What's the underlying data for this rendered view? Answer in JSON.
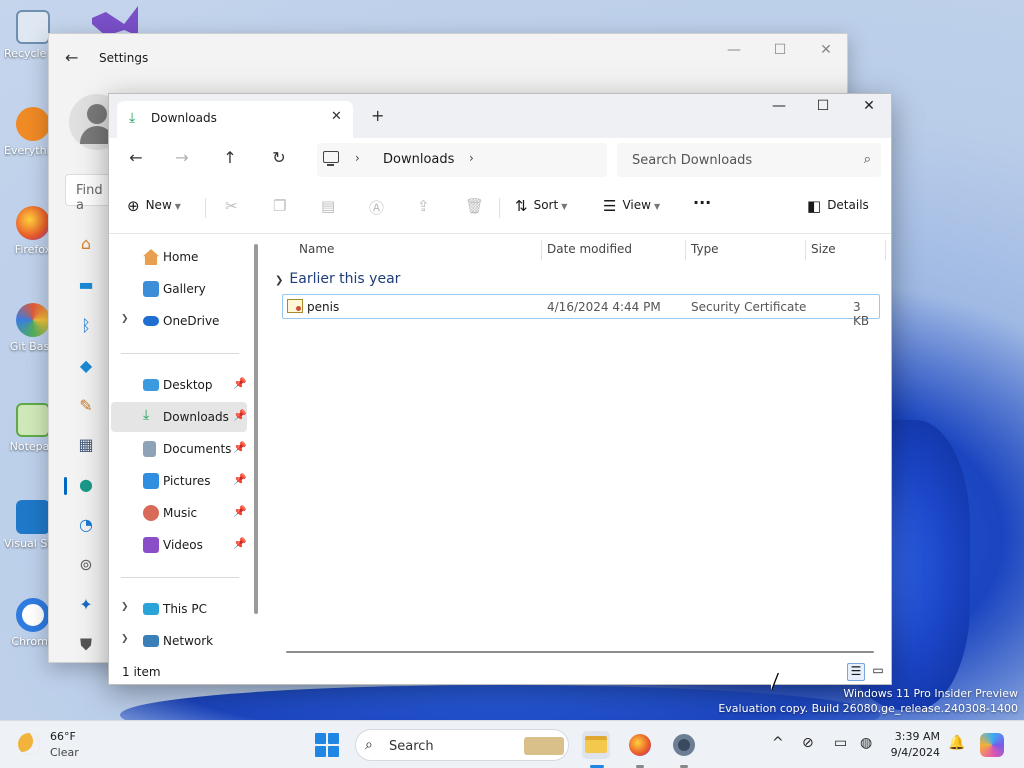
{
  "desktop": {
    "icons": [
      {
        "label": "Recycle Bin",
        "icon": "recycle-bin-icon",
        "color": "#6f8fb0"
      },
      {
        "label": "Everything",
        "icon": "search-tool-icon",
        "color": "#f08a24"
      },
      {
        "label": "Firefox",
        "icon": "firefox-icon",
        "color": "#e8582b"
      },
      {
        "label": "Git Bash",
        "icon": "git-bash-icon",
        "color": "#e05a3a"
      },
      {
        "label": "Notepad",
        "icon": "notepad-icon",
        "color": "#5fa94a"
      },
      {
        "label": "Visual Studio Code",
        "icon": "vscode-icon",
        "color": "#1f78c8"
      },
      {
        "label": "Chrome",
        "icon": "chrome-icon",
        "color": "#2f7be0"
      }
    ],
    "watermark_line1": "Windows 11 Pro Insider Preview",
    "watermark_line2": "Evaluation copy. Build 26080.ge_release.240308-1400"
  },
  "settings": {
    "title": "Settings",
    "search_placeholder": "Find a",
    "nav_icons": [
      "home-icon",
      "system-icon",
      "bluetooth-icon",
      "network-icon",
      "personalization-icon",
      "apps-icon",
      "accounts-icon",
      "time-language-icon",
      "gaming-icon",
      "accessibility-icon",
      "privacy-icon"
    ]
  },
  "explorer": {
    "tab_label": "Downloads",
    "address": {
      "crumb": "Downloads"
    },
    "search_placeholder": "Search Downloads",
    "toolbar": {
      "new": "New",
      "sort": "Sort",
      "view": "View",
      "details": "Details"
    },
    "nav": {
      "home": "Home",
      "gallery": "Gallery",
      "onedrive": "OneDrive",
      "desktop": "Desktop",
      "downloads": "Downloads",
      "documents": "Documents",
      "pictures": "Pictures",
      "music": "Music",
      "videos": "Videos",
      "thispc": "This PC",
      "network": "Network"
    },
    "columns": {
      "name": "Name",
      "date": "Date modified",
      "type": "Type",
      "size": "Size"
    },
    "group": "Earlier this year",
    "files": [
      {
        "name": "penis",
        "date": "4/16/2024 4:44 PM",
        "type": "Security Certificate",
        "size": "3 KB"
      }
    ],
    "status": "1 item"
  },
  "taskbar": {
    "weather_temp": "66°F",
    "weather_cond": "Clear",
    "search_label": "Search",
    "time": "3:39 AM",
    "date": "9/4/2024",
    "accent": "#1f86e4"
  }
}
